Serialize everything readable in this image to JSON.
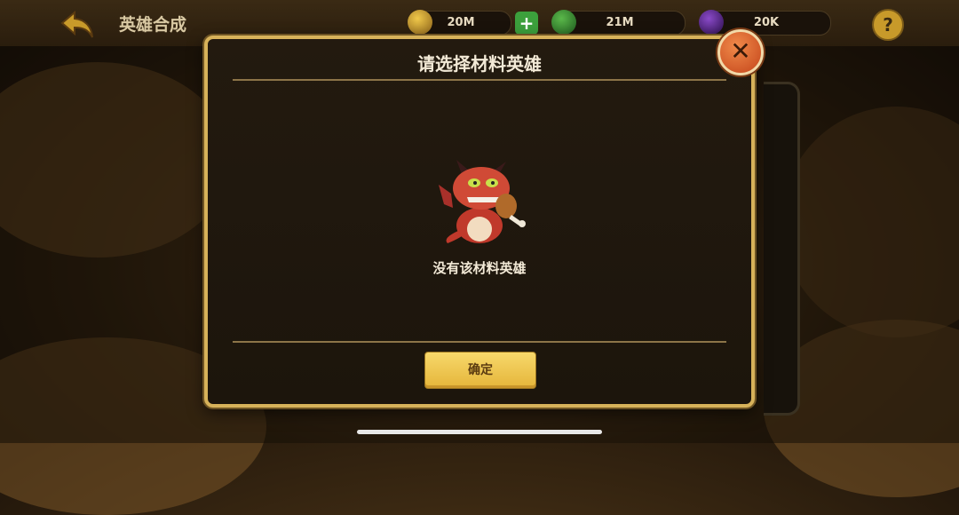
{
  "header": {
    "title": "英雄合成",
    "resources": [
      {
        "icon": "gold-coin-icon",
        "value": "20M",
        "color": "#c89a2a"
      },
      {
        "icon": "green-gem-icon",
        "value": "21M",
        "color": "#3c8a3c"
      },
      {
        "icon": "purple-crystal-icon",
        "value": "20K",
        "color": "#5a2a8a"
      }
    ],
    "help_label": "?"
  },
  "modal": {
    "title": "请选择材料英雄",
    "empty_message": "没有该材料英雄",
    "confirm_label": "确定",
    "close_label": "✕"
  }
}
